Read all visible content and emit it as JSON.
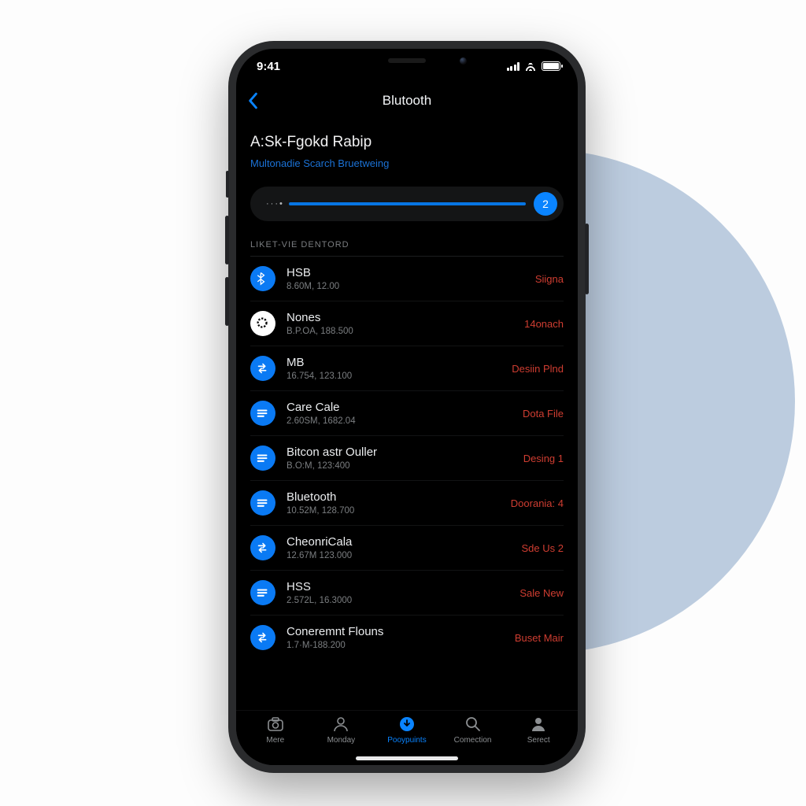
{
  "status": {
    "time": "9:41"
  },
  "nav": {
    "title": "Blutooth"
  },
  "header": {
    "title": "A:Sk-Fgokd Rabip",
    "subtitle": "Multonadie Scarch Bruetweing"
  },
  "slider": {
    "dots": "···•",
    "value": "2"
  },
  "section_label": "LIKET-VIE DENTORD",
  "devices": [
    {
      "name": "HSB",
      "sub": "8.60M, 12.00",
      "status": "Siigna",
      "icon": "bluetooth",
      "style": "blue"
    },
    {
      "name": "Nones",
      "sub": "B.P.OA, 188.500",
      "status": "14onach",
      "icon": "ring",
      "style": "white"
    },
    {
      "name": "MB",
      "sub": "16.754, 123.100",
      "status": "Desiin Plnd",
      "icon": "swap",
      "style": "blue"
    },
    {
      "name": "Care Cale",
      "sub": "2.60SM, 1682.04",
      "status": "Dota File",
      "icon": "bars",
      "style": "blue"
    },
    {
      "name": "Bitcon astr Ouller",
      "sub": "B.O:M, 123:400",
      "status": "Desing 1",
      "icon": "bars",
      "style": "blue"
    },
    {
      "name": "Bluetooth",
      "sub": "10.52M, 128.700",
      "status": "Doorania: 4",
      "icon": "bars",
      "style": "blue"
    },
    {
      "name": "CheonriCala",
      "sub": "12.67M 123.000",
      "status": "Sde Us 2",
      "icon": "swap",
      "style": "blue"
    },
    {
      "name": "HSS",
      "sub": "2.572L, 16.3000",
      "status": "Sale New",
      "icon": "bars",
      "style": "blue"
    },
    {
      "name": "Coneremnt Flouns",
      "sub": "1.7·M-188.200",
      "status": "Buset Mair",
      "icon": "swap",
      "style": "blue"
    }
  ],
  "tabs": [
    {
      "label": "Mere",
      "icon": "camera"
    },
    {
      "label": "Monday",
      "icon": "person"
    },
    {
      "label": "Pooypuints",
      "icon": "download",
      "active": true
    },
    {
      "label": "Comection",
      "icon": "search"
    },
    {
      "label": "Serect",
      "icon": "person2"
    }
  ]
}
